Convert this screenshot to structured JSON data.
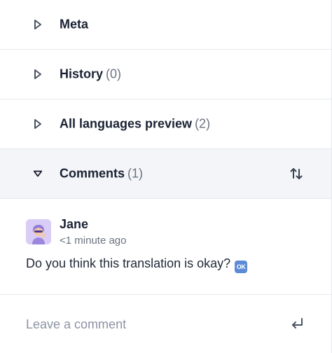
{
  "sections": [
    {
      "label": "Meta",
      "count": "",
      "expanded": false
    },
    {
      "label": "History",
      "count": "(0)",
      "expanded": false
    },
    {
      "label": "All languages preview",
      "count": "(2)",
      "expanded": false
    },
    {
      "label": "Comments",
      "count": "(1)",
      "expanded": true
    }
  ],
  "comment": {
    "author": "Jane",
    "time": "<1 minute ago",
    "text": "Do you think this translation is okay?",
    "emoji_label": "OK"
  },
  "composer": {
    "placeholder": "Leave a comment"
  },
  "icons": {
    "collapsed": "triangle-right-icon",
    "expanded": "triangle-down-icon",
    "sort": "sort-arrows-icon",
    "submit": "enter-return-icon"
  }
}
